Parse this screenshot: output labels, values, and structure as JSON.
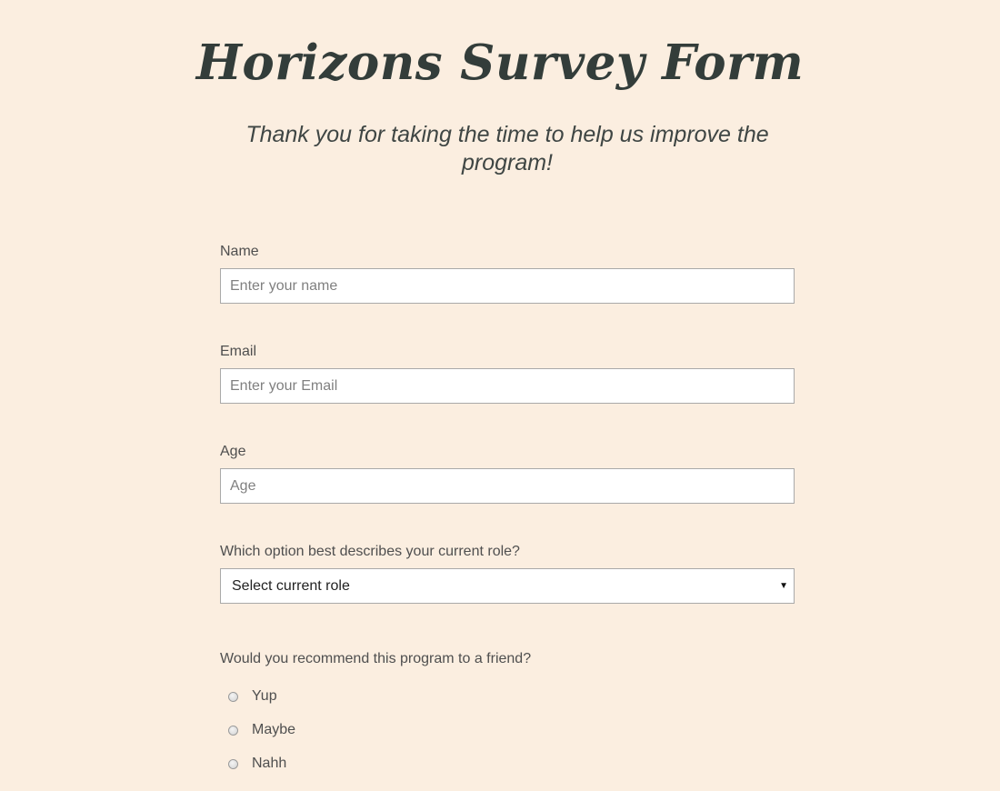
{
  "header": {
    "title": "Horizons Survey Form",
    "description": "Thank you for taking the time to help us improve the program!"
  },
  "form": {
    "name": {
      "label": "Name",
      "placeholder": "Enter your name",
      "value": ""
    },
    "email": {
      "label": "Email",
      "placeholder": "Enter your Email",
      "value": ""
    },
    "age": {
      "label": "Age",
      "placeholder": "Age",
      "value": ""
    },
    "role": {
      "label": "Which option best describes your current role?",
      "selected": "Select current role"
    },
    "recommend": {
      "question": "Would you recommend this program to a friend?",
      "options": [
        "Yup",
        "Maybe",
        "Nahh"
      ]
    }
  },
  "colors": {
    "background": "#fbeee0",
    "title": "#333d3a",
    "text": "#4f4f4f",
    "input_border": "#a9a9a9"
  }
}
